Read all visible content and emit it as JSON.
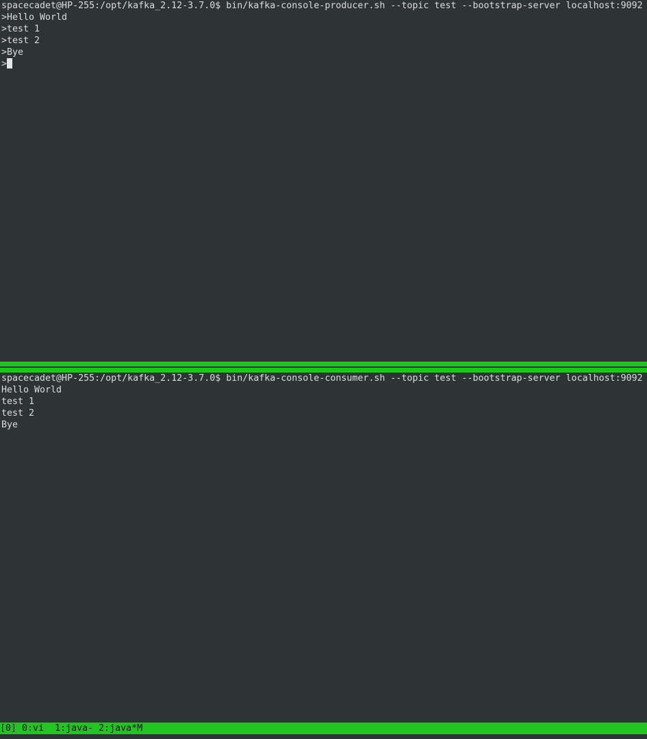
{
  "producer_pane": {
    "command": "spacecadet@HP-255:/opt/kafka_2.12-3.7.0$ bin/kafka-console-producer.sh --topic test --bootstrap-server localhost:9092",
    "lines": [
      ">Hello World",
      ">test 1",
      ">test 2",
      ">Bye"
    ],
    "prompt": ">"
  },
  "consumer_pane": {
    "command": "spacecadet@HP-255:/opt/kafka_2.12-3.7.0$ bin/kafka-console-consumer.sh --topic test --bootstrap-server localhost:9092",
    "lines": [
      "Hello World",
      "test 1",
      "test 2",
      "Bye"
    ]
  },
  "status_bar": {
    "session": "[0]",
    "windows": [
      {
        "label": "0:vi"
      },
      {
        "label": "1:java-"
      },
      {
        "label": "2:java*M"
      }
    ]
  },
  "colors": {
    "background": "#2e3336",
    "foreground": "#dcdcdc",
    "tmux_green": "#21c421"
  }
}
